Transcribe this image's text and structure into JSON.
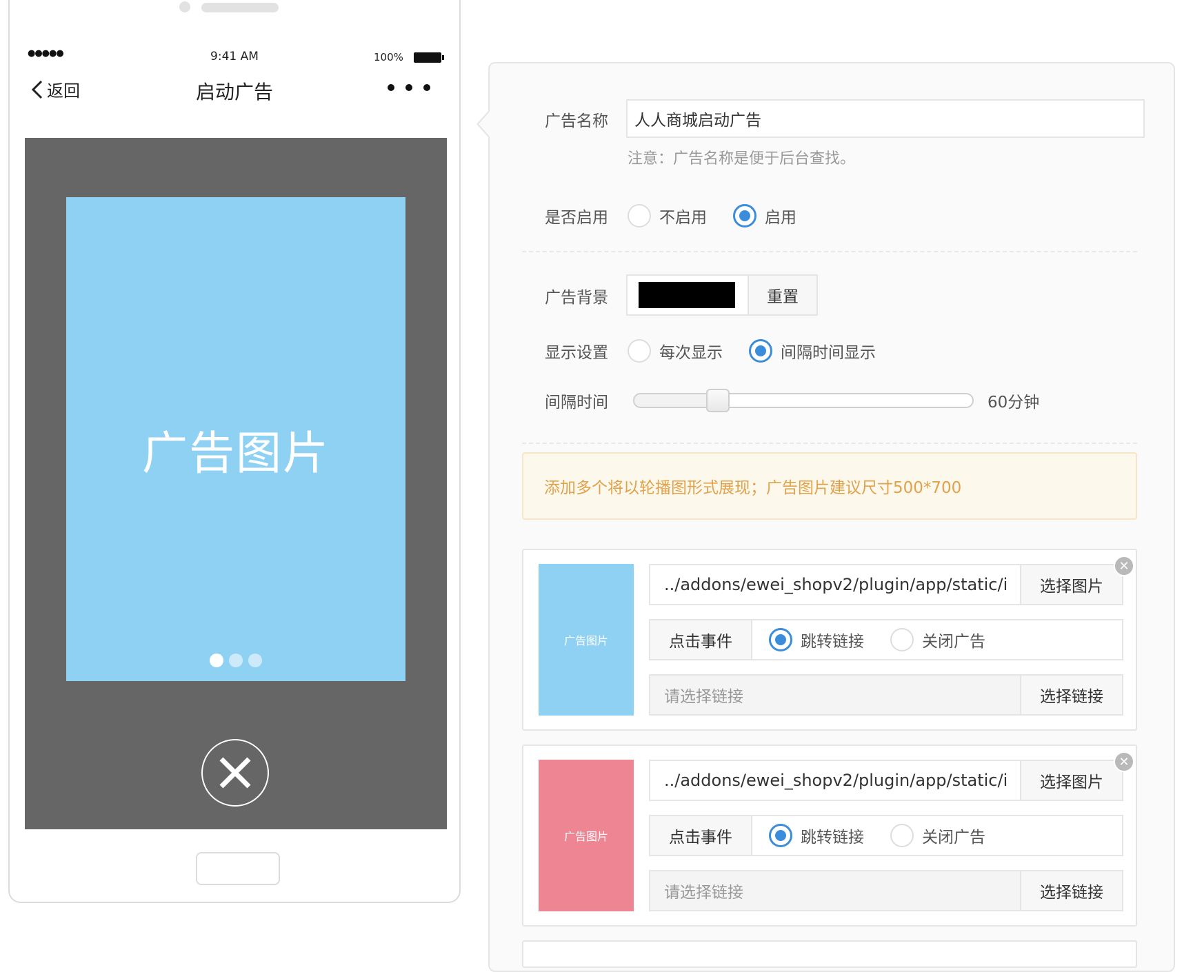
{
  "phone": {
    "status": {
      "signal": "●●●●●",
      "time": "9:41 AM",
      "battery": "100%"
    },
    "nav": {
      "back_label": "返回",
      "title": "启动广告"
    },
    "preview": {
      "image_label": "广告图片",
      "image_color": "#8fd1f3",
      "screen_color": "#666666",
      "dots_total": 3,
      "dots_active": 1
    }
  },
  "form": {
    "name": {
      "label": "广告名称",
      "value": "人人商城启动广告",
      "help": "注意：广告名称是便于后台查找。"
    },
    "enabled": {
      "label": "是否启用",
      "options": [
        "不启用",
        "启用"
      ],
      "selected": "启用"
    },
    "background": {
      "label": "广告背景",
      "color": "#000000",
      "reset_label": "重置"
    },
    "display": {
      "label": "显示设置",
      "options": [
        "每次显示",
        "间隔时间显示"
      ],
      "selected": "间隔时间显示"
    },
    "interval": {
      "label": "间隔时间",
      "value": 60,
      "value_text": "60分钟"
    },
    "notice": "添加多个将以轮播图形式展现；广告图片建议尺寸500*700",
    "ads": [
      {
        "thumb_label": "广告图片",
        "thumb_color": "#8fd1f3",
        "path": "../addons/ewei_shopv2/plugin/app/static/i",
        "pick_image_label": "选择图片",
        "event_label": "点击事件",
        "event_options": [
          "跳转链接",
          "关闭广告"
        ],
        "event_selected": "跳转链接",
        "link_placeholder": "请选择链接",
        "pick_link_label": "选择链接"
      },
      {
        "thumb_label": "广告图片",
        "thumb_color": "#ee8593",
        "path": "../addons/ewei_shopv2/plugin/app/static/i",
        "pick_image_label": "选择图片",
        "event_label": "点击事件",
        "event_options": [
          "跳转链接",
          "关闭广告"
        ],
        "event_selected": "跳转链接",
        "link_placeholder": "请选择链接",
        "pick_link_label": "选择链接"
      }
    ]
  }
}
